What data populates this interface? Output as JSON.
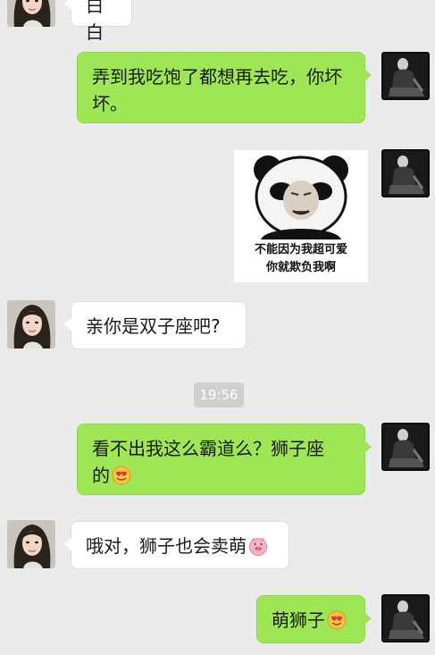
{
  "messages": [
    {
      "side": "left",
      "text": "白白"
    },
    {
      "side": "right",
      "text": "弄到我吃饱了都想再去吃，你坏坏。"
    },
    {
      "side": "right",
      "sticker_caption_line1": "不能因为我超可爱",
      "sticker_caption_line2": "你就欺负我啊"
    },
    {
      "side": "left",
      "text": "亲你是双子座吧?"
    },
    {
      "side": "right",
      "text_line1": "看不出我这么霸道么？狮子座",
      "text_line2": "的",
      "emoji": "smiling-heart-eyes-emoji"
    },
    {
      "side": "left",
      "text": "哦对，狮子也会卖萌",
      "emoji": "pig-face-emoji"
    },
    {
      "side": "right",
      "text": "萌狮子",
      "emoji": "smiling-heart-eyes-emoji"
    }
  ],
  "timestamp": "19:56",
  "colors": {
    "background": "#ebebeb",
    "right_bubble": "#9ee656",
    "left_bubble": "#ffffff",
    "timestamp_bg": "#cfcfcf"
  }
}
